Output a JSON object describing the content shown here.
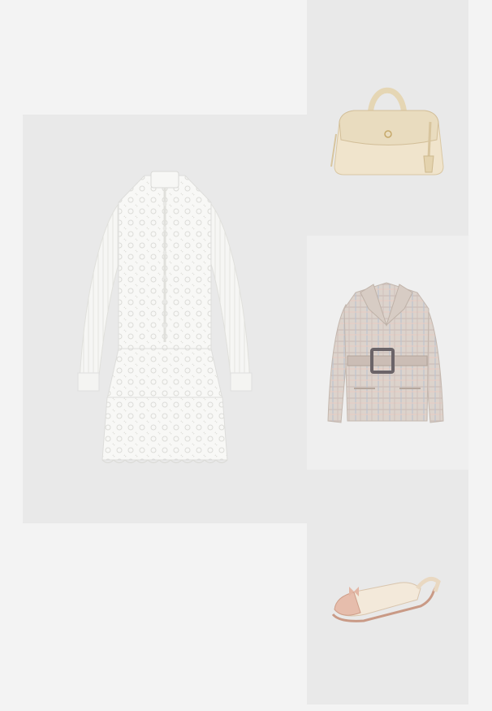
{
  "outfit": {
    "items": [
      {
        "key": "dress",
        "icon": "lace-dress-icon"
      },
      {
        "key": "bag",
        "icon": "handbag-icon"
      },
      {
        "key": "blazer",
        "icon": "plaid-blazer-icon"
      },
      {
        "key": "shoe",
        "icon": "slingback-flat-icon"
      }
    ]
  },
  "colors": {
    "page_bg": "#f3f3f3",
    "tile_bg": "#e9e9e9",
    "dress": "#f7f7f5",
    "bag": "#efe3c9",
    "blazer": "#d9cfc8",
    "shoe": "#f1e6d6",
    "shoe_toe": "#e8c2b2"
  }
}
